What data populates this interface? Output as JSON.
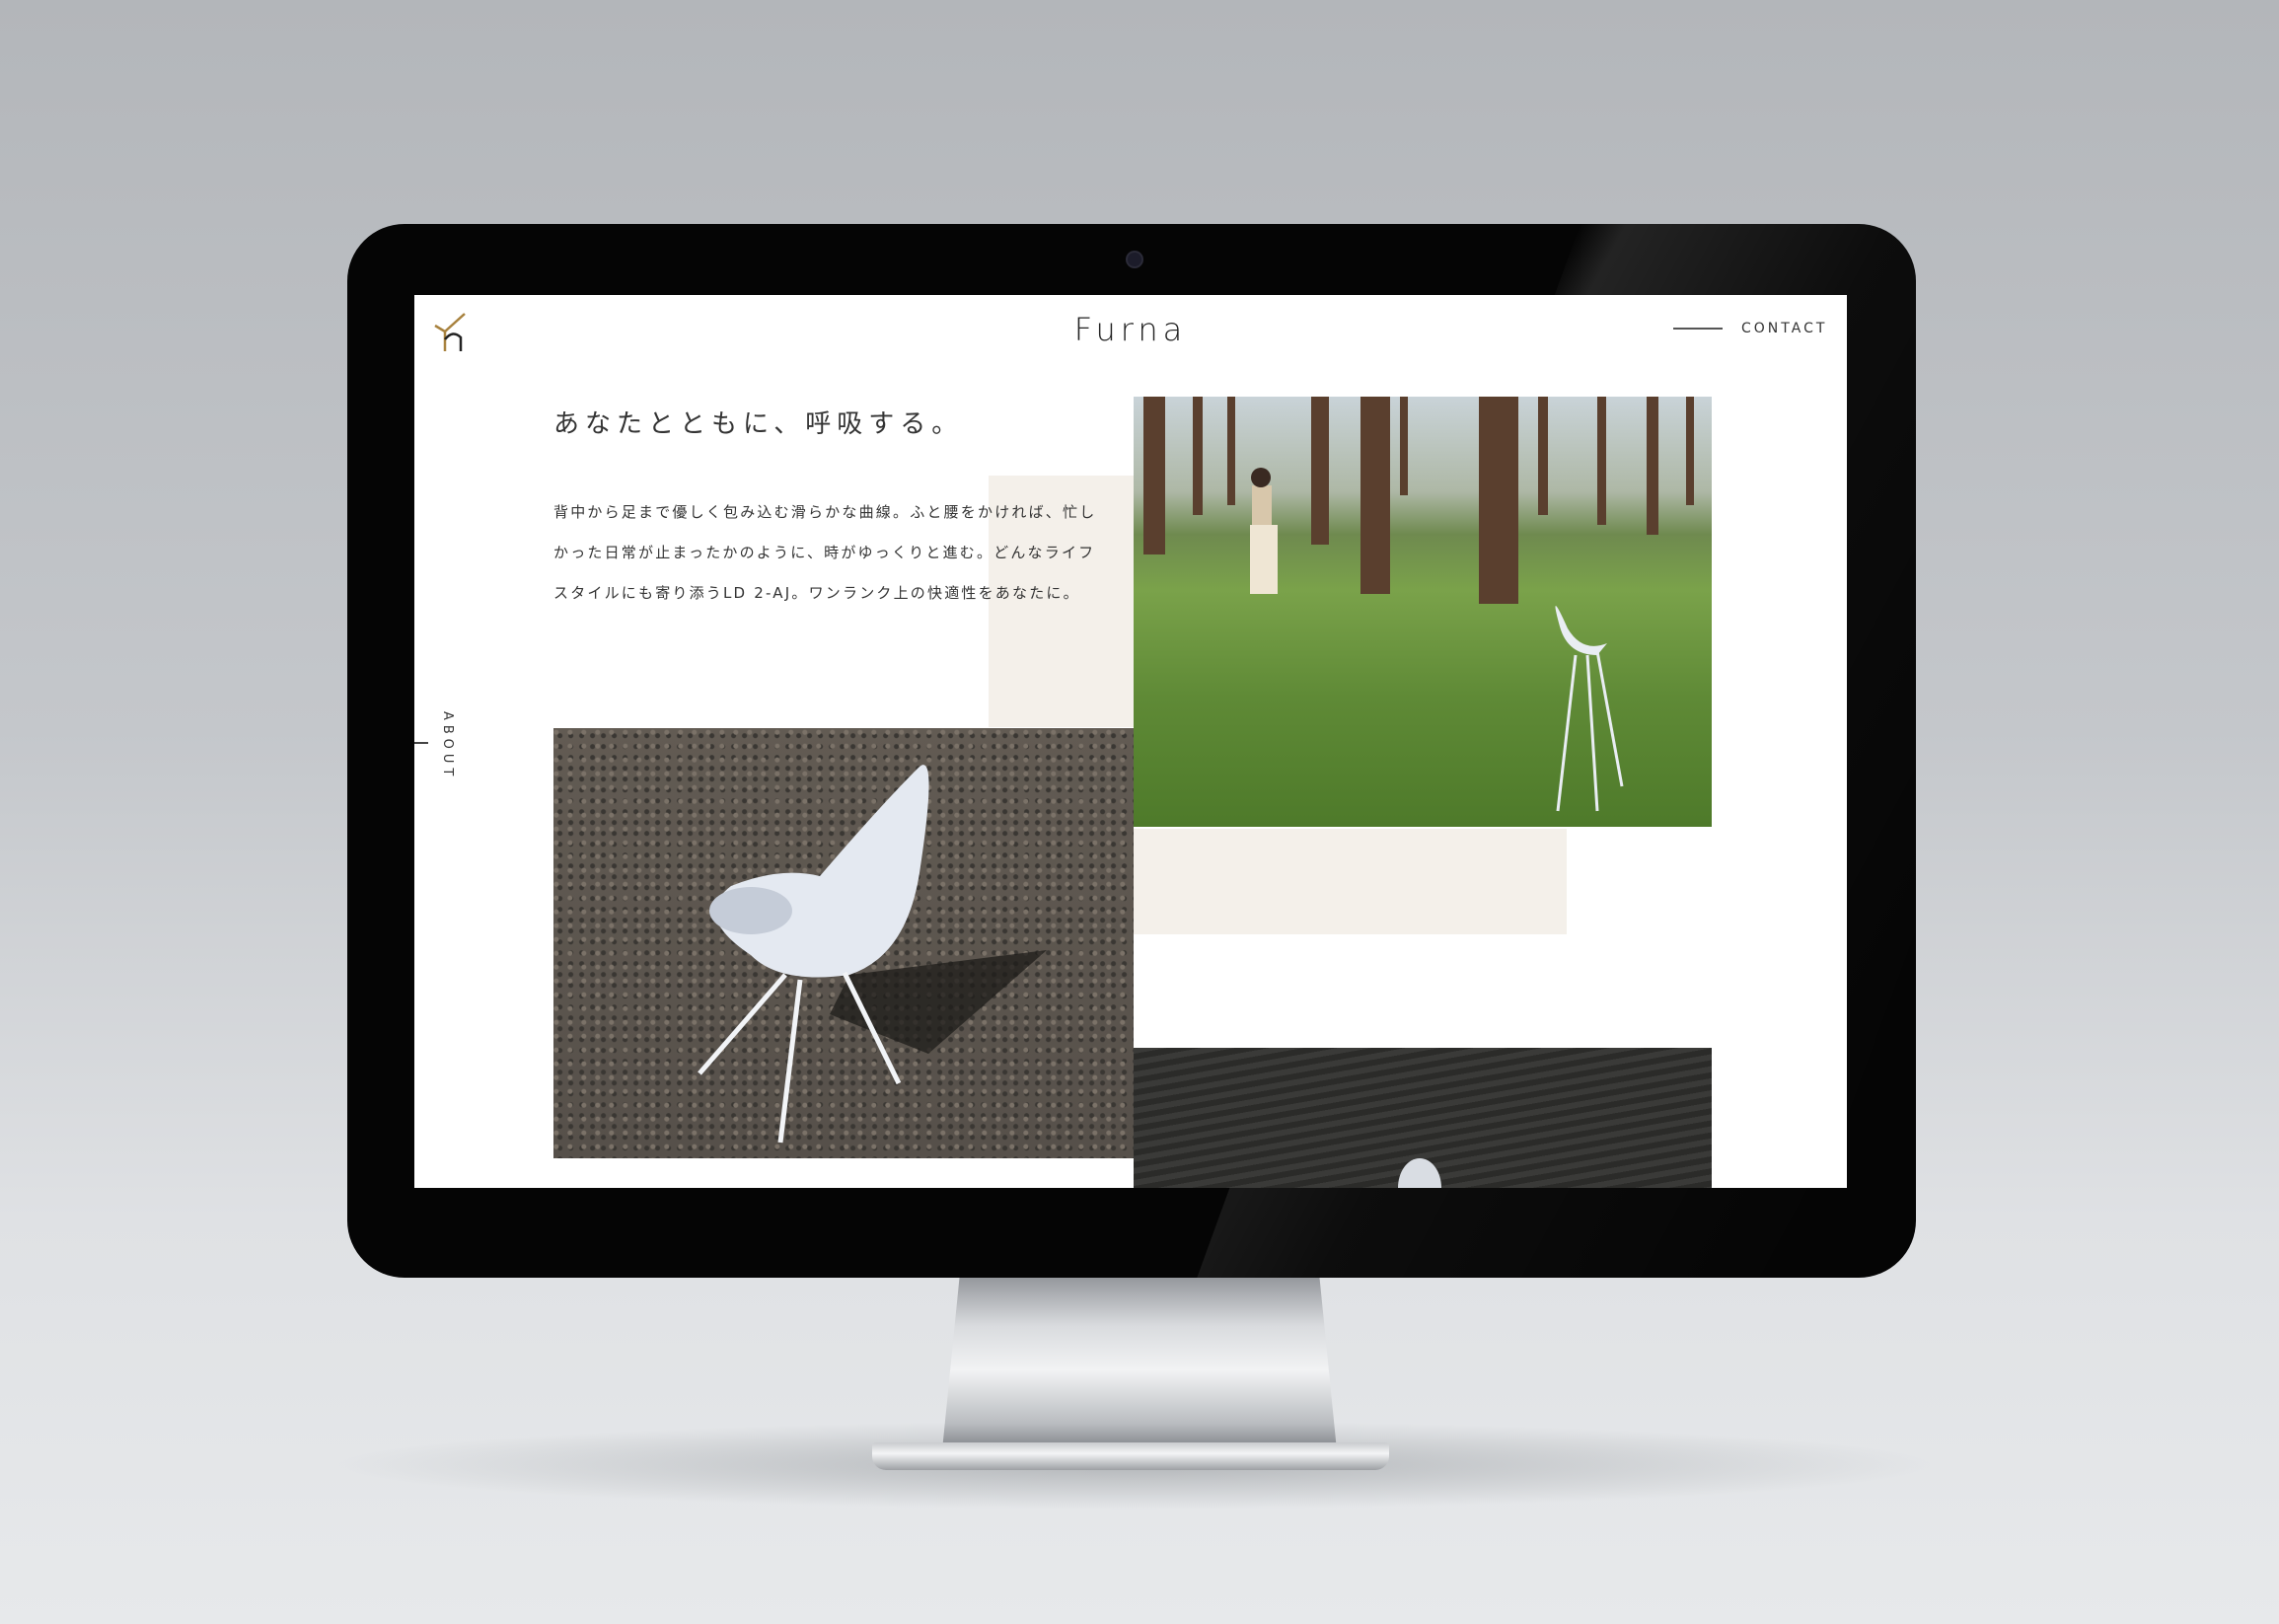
{
  "header": {
    "logo_alt": "Furna logo",
    "brand": "Furna",
    "contact_label": "CONTACT"
  },
  "sidebar": {
    "about_label": "ABOUT"
  },
  "main": {
    "heading": "あなたとともに、呼吸する。",
    "paragraph_lines": [
      "背中から足まで優しく包み込む滑らかな曲線。ふと腰をかければ、忙し",
      "かった日常が止まったかのように、時がゆっくりと進む。どんなライフ",
      "スタイルにも寄り添うLD 2-AJ。ワンランク上の快適性をあなたに。"
    ]
  },
  "colors": {
    "accent_gold": "#a8823e",
    "beige_block": "#f4f0ea",
    "text": "#333333"
  }
}
